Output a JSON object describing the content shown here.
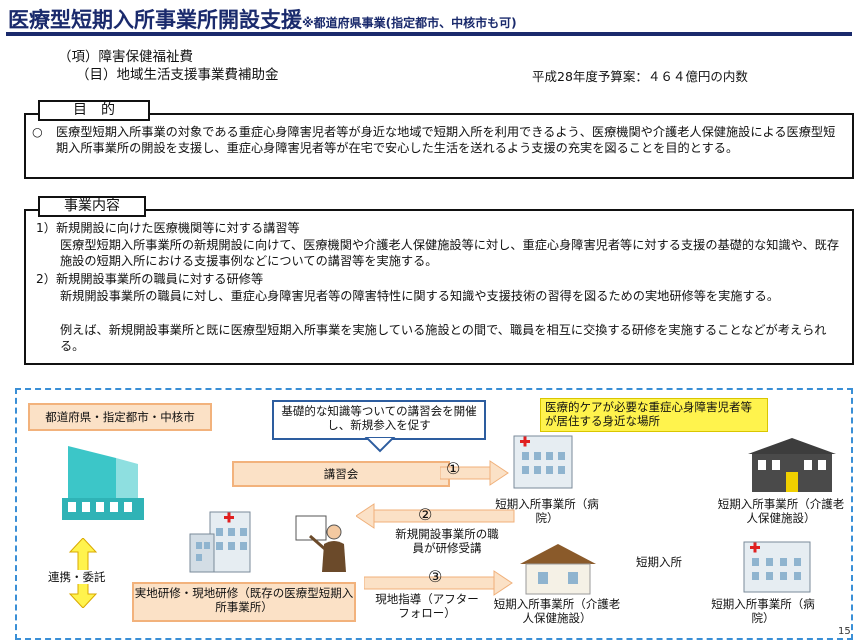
{
  "header": {
    "title": "医療型短期入所事業所開設支援",
    "title_note": "※都道府県事業(指定都市、中核市も可)"
  },
  "budget": {
    "category": "（項）障害保健福祉費",
    "subcategory": "（目）地域生活支援事業費補助金",
    "amount": "平成28年度予算案：４６４億円の内数"
  },
  "purpose": {
    "label": "目　的",
    "bullet": "○",
    "text": "医療型短期入所事業の対象である重症心身障害児者等が身近な地域で短期入所を利用できるよう、医療機関や介護老人保健施設による医療型短期入所事業所の開設を支援し、重症心身障害児者等が在宅で安心した生活を送れるよう支援の充実を図ることを目的とする。"
  },
  "content": {
    "label": "事業内容",
    "item1_title": "1）新規開設に向けた医療機関等に対する講習等",
    "item1_text": "医療型短期入所事業所の新規開設に向けて、医療機関や介護老人保健施設等に対し、重症心身障害児者等に対する支援の基礎的な知識や、既存施設の短期入所における支援事例などについての講習等を実施する。",
    "item2_title": "2）新規開設事業所の職員に対する研修等",
    "item2_text": "新規開設事業所の職員に対し、重症心身障害児者等の障害特性に関する知識や支援技術の習得を図るための実地研修等を実施する。",
    "item2_text2": "例えば、新規開設事業所と既に医療型短期入所事業を実施している施設との間で、職員を相互に交換する研修を実施することなどが考えられる。"
  },
  "diagram": {
    "prefecture_label": "都道府県・指定都市・中核市",
    "callout_text": "基礎的な知識等ついての講習会を開催し、新規参入を促す",
    "lecture_label": "講習会",
    "step1": "①",
    "step2": "②",
    "step3": "③",
    "step2_label": "新規開設事業所の職員が研修受講",
    "step3_label": "現地指導（アフターフォロー）",
    "cooperation_label": "連携・委託",
    "training_label": "実地研修・現地研修（既存の医療型短期入所事業所）",
    "area_label": "医療的ケアが必要な重症心身障害児者等が居住する身近な場所",
    "short_stay_label": "短期入所",
    "facility_hospital_top": "短期入所事業所（病院）",
    "facility_nursing_top": "短期入所事業所（介護老人保健施設）",
    "facility_nursing_bottom": "短期入所事業所（介護老人保健施設）",
    "facility_hospital_bottom": "短期入所事業所（病院）",
    "page_number": "15",
    "colors": {
      "accent": "#1a2a6c",
      "peach": "#fbe1c6",
      "yellow": "#fff34d",
      "dashed": "#3a8fd6",
      "cyan": "#3cc6c8"
    }
  }
}
